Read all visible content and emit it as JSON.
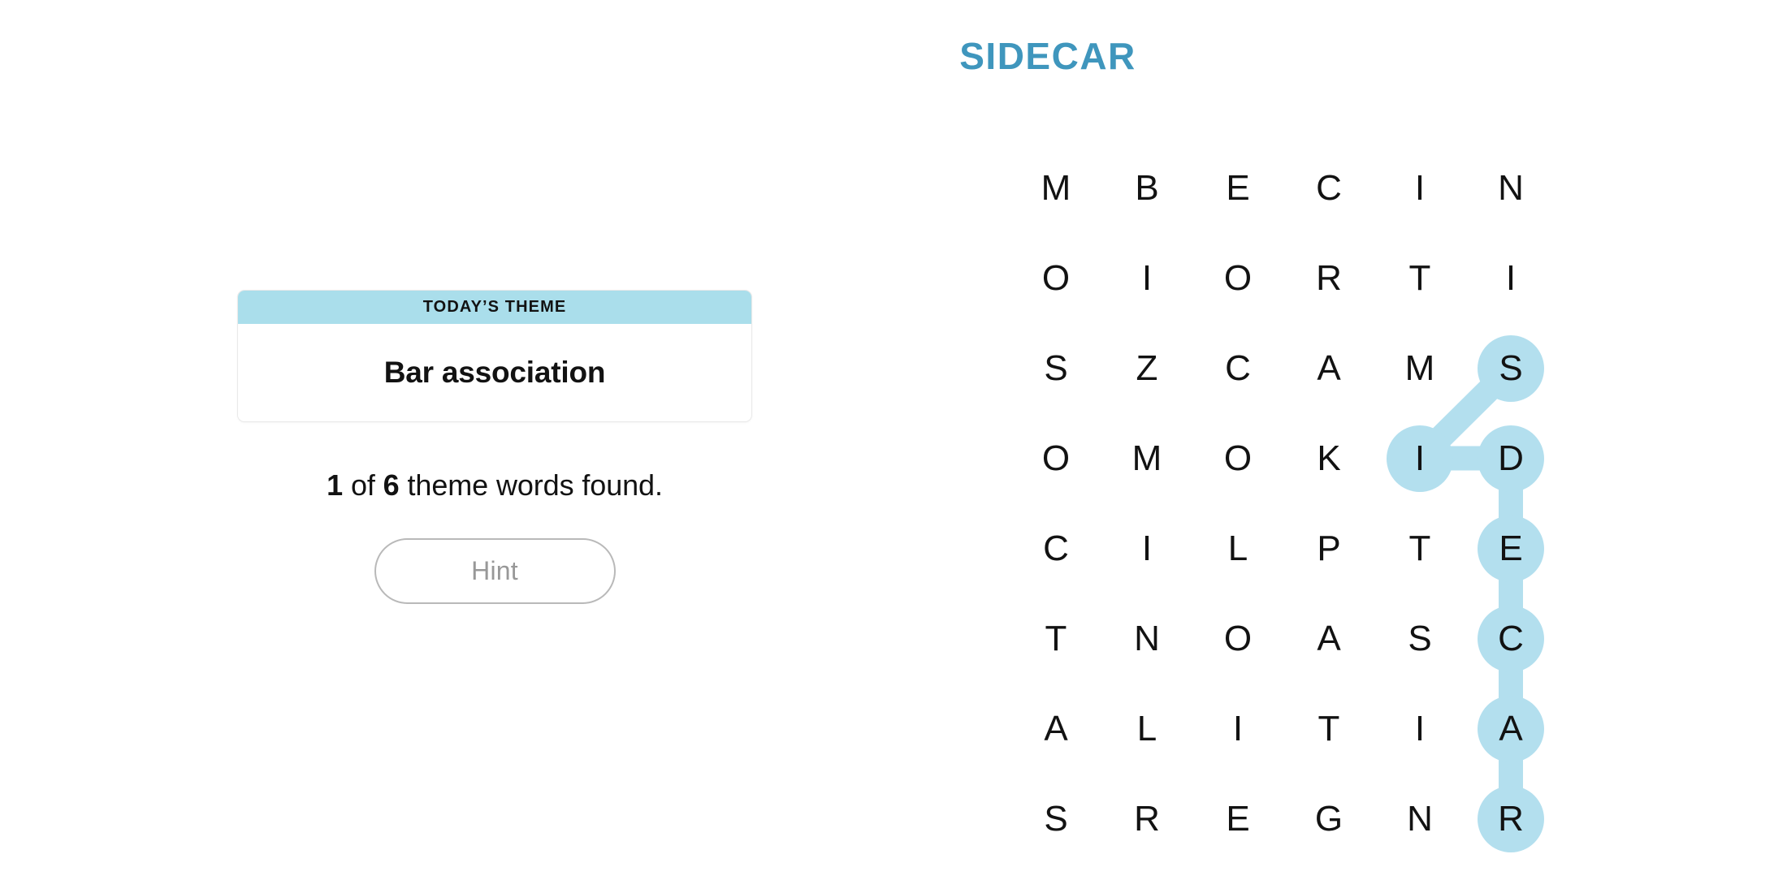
{
  "puzzle": {
    "title": "SIDECAR",
    "title_color": "#3f96bd"
  },
  "theme_card": {
    "header_label": "TODAY’S THEME",
    "theme": "Bar association",
    "header_color": "#aadeeb"
  },
  "progress": {
    "found": "1",
    "of_label": "of",
    "total": "6",
    "suffix": "theme words found."
  },
  "hint": {
    "label": "Hint",
    "enabled": false
  },
  "board": {
    "rows": 8,
    "cols": 6,
    "letters": [
      [
        "M",
        "B",
        "E",
        "C",
        "I",
        "N"
      ],
      [
        "O",
        "I",
        "O",
        "R",
        "T",
        "I"
      ],
      [
        "S",
        "Z",
        "C",
        "A",
        "M",
        "S"
      ],
      [
        "O",
        "M",
        "O",
        "K",
        "I",
        "D"
      ],
      [
        "C",
        "I",
        "L",
        "P",
        "T",
        "E"
      ],
      [
        "T",
        "N",
        "O",
        "A",
        "S",
        "C"
      ],
      [
        "A",
        "L",
        "I",
        "T",
        "I",
        "A"
      ],
      [
        "S",
        "R",
        "E",
        "G",
        "N",
        "R"
      ]
    ],
    "selection": {
      "word": "SIDECAR",
      "highlight_color": "#b3dfee",
      "path": [
        {
          "row": 2,
          "col": 5,
          "letter": "S"
        },
        {
          "row": 3,
          "col": 4,
          "letter": "I"
        },
        {
          "row": 3,
          "col": 5,
          "letter": "D"
        },
        {
          "row": 4,
          "col": 5,
          "letter": "E"
        },
        {
          "row": 5,
          "col": 5,
          "letter": "C"
        },
        {
          "row": 6,
          "col": 5,
          "letter": "A"
        },
        {
          "row": 7,
          "col": 5,
          "letter": "R"
        }
      ]
    }
  }
}
